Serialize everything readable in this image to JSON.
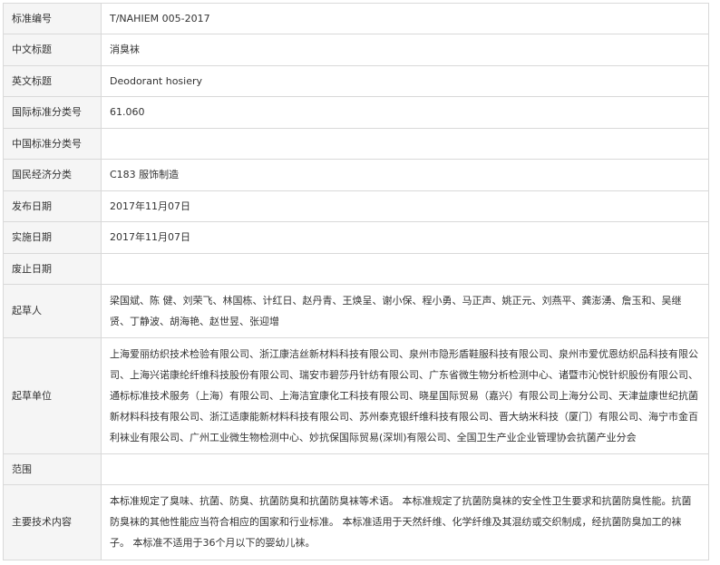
{
  "rows": [
    {
      "label": "标准编号",
      "value": "T/NAHIEM 005-2017"
    },
    {
      "label": "中文标题",
      "value": "消臭袜"
    },
    {
      "label": "英文标题",
      "value": "Deodorant hosiery"
    },
    {
      "label": "国际标准分类号",
      "value": "61.060"
    },
    {
      "label": "中国标准分类号",
      "value": ""
    },
    {
      "label": "国民经济分类",
      "value": "C183 服饰制造"
    },
    {
      "label": "发布日期",
      "value": "2017年11月07日"
    },
    {
      "label": "实施日期",
      "value": "2017年11月07日"
    },
    {
      "label": "废止日期",
      "value": ""
    },
    {
      "label": "起草人",
      "value": "梁国斌、陈 健、刘荣飞、林国栋、计红日、赵丹青、王焕呈、谢小保、程小勇、马正声、姚正元、刘燕平、龚澎湧、詹玉和、吴继贤、丁静波、胡海艳、赵世昱、张迎增"
    },
    {
      "label": "起草单位",
      "value": "上海爱丽纺织技术检验有限公司、浙江康洁丝新材料科技有限公司、泉州市隐形盾鞋服科技有限公司、泉州市爱优恩纺织品科技有限公司、上海兴诺康纶纤维科技股份有限公司、瑞安市碧莎丹针纺有限公司、广东省微生物分析检测中心、诸暨市沁悦针织股份有限公司、通标标准技术服务（上海）有限公司、上海洁宜康化工科技有限公司、晓星国际贸易（嘉兴）有限公司上海分公司、天津益康世纪抗菌新材料科技有限公司、浙江适康能新材料科技有限公司、苏州泰克银纤维科技有限公司、晋大纳米科技（厦门）有限公司、海宁市金百利袜业有限公司、广州工业微生物检测中心、妙抗保国际贸易(深圳)有限公司、全国卫生产业企业管理协会抗菌产业分会"
    },
    {
      "label": "范围",
      "value": ""
    },
    {
      "label": "主要技术内容",
      "value": "本标准规定了臭味、抗菌、防臭、抗菌防臭和抗菌防臭袜等术语。 本标准规定了抗菌防臭袜的安全性卫生要求和抗菌防臭性能。抗菌防臭袜的其他性能应当符合相应的国家和行业标准。 本标准适用于天然纤维、化学纤维及其混纺或交织制成，经抗菌防臭加工的袜子。 本标准不适用于36个月以下的婴幼儿袜。"
    }
  ]
}
